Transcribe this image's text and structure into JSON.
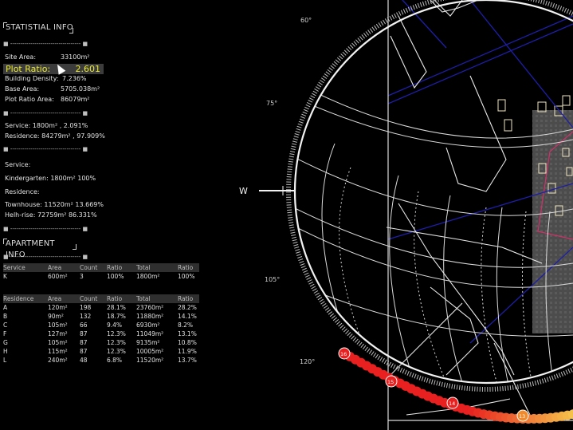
{
  "stat_header": "STATISTIAL INFO",
  "separator": "■ ----------------------------------- ■",
  "site_area": {
    "label": "Site Area:",
    "value": "33100m²"
  },
  "plot_ratio": {
    "label": "Plot Ratio:",
    "value": "2.601"
  },
  "building_density": {
    "label": "Building Density:",
    "value": "7.236%"
  },
  "base_area": {
    "label": "Base Area:",
    "value": "5705.038m²"
  },
  "plot_ratio_area": {
    "label": "Plot Ratio Area:",
    "value": "86079m²"
  },
  "service_line": "Service:   1800m² , 2.091%",
  "residence_line": "Residence:   84279m² , 97.909%",
  "service_title": "Service:",
  "kindergarten_line": "Kindergarten:   1800m²  100%",
  "residence_title": "Residence:",
  "townhouse_line": "Townhouse:   11520m²  13.669%",
  "highrise_line": "Helh-rise:   72759m²  86.331%",
  "apt_header": "APARTMENT INFO",
  "service_table": {
    "headers": [
      "Service",
      "Area",
      "Count",
      "Ratio",
      "Total",
      "Ratio"
    ],
    "rows": [
      [
        "K",
        "600m²",
        "3",
        "100%",
        "1800m²",
        "100%"
      ]
    ]
  },
  "residence_table": {
    "headers": [
      "Residence",
      "Area",
      "Count",
      "Ratio",
      "Total",
      "Ratio"
    ],
    "rows": [
      [
        "A",
        "120m²",
        "198",
        "28.1%",
        "23760m²",
        "28.2%"
      ],
      [
        "B",
        "90m²",
        "132",
        "18.7%",
        "11880m²",
        "14.1%"
      ],
      [
        "C",
        "105m²",
        "66",
        "9.4%",
        "6930m²",
        "8.2%"
      ],
      [
        "F",
        "127m²",
        "87",
        "12.3%",
        "11049m²",
        "13.1%"
      ],
      [
        "G",
        "105m²",
        "87",
        "12.3%",
        "9135m²",
        "10.8%"
      ],
      [
        "H",
        "115m²",
        "87",
        "12.3%",
        "10005m²",
        "11.9%"
      ],
      [
        "L",
        "240m²",
        "48",
        "6.8%",
        "11520m²",
        "13.7%"
      ]
    ]
  },
  "compass": {
    "west_label": "W",
    "angles": [
      "60°",
      "75°",
      "105°",
      "120°"
    ],
    "hours": [
      "16",
      "15",
      "14",
      "13"
    ]
  },
  "colors": {
    "accent_yellow": "#eaea3a",
    "sun_red": "#e8201f",
    "sun_orange": "#f08a2a",
    "road_blue": "#1e1ea8"
  }
}
